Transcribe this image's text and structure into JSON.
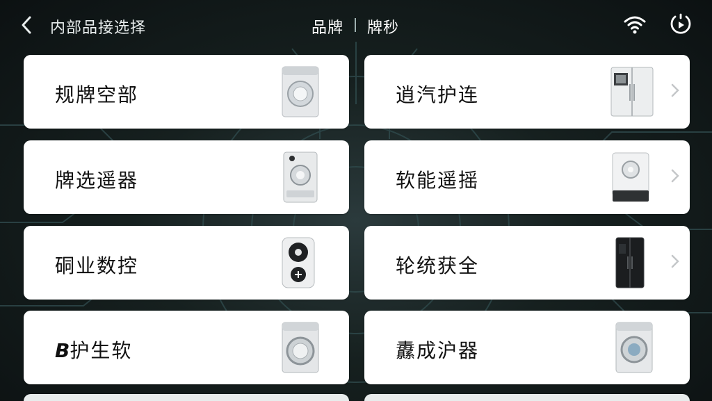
{
  "header": {
    "back_icon": "chevron-left-icon",
    "title": "内部品接选择",
    "center_left": "品牌",
    "center_right": "牌秒",
    "wifi_icon": "wifi-icon",
    "timer_icon": "timer-play-icon"
  },
  "devices": [
    {
      "label": "规牌空部",
      "icon": "front-load-washer-icon",
      "chevron": false
    },
    {
      "label": "逍汽护连",
      "icon": "double-door-fridge-icon",
      "chevron": true
    },
    {
      "label": "牌选遥器",
      "icon": "washer-dial-icon",
      "chevron": false
    },
    {
      "label": "软能遥摇",
      "icon": "heater-icon",
      "chevron": true
    },
    {
      "label": "硐业数控",
      "icon": "remote-control-icon",
      "chevron": false
    },
    {
      "label": "轮统获全",
      "icon": "dark-fridge-icon",
      "chevron": true
    },
    {
      "label_prefix": "B",
      "label": "护生软",
      "icon": "washing-machine-icon",
      "chevron": false
    },
    {
      "label": "纛成沪器",
      "icon": "washing-machine-icon",
      "chevron": false
    }
  ]
}
